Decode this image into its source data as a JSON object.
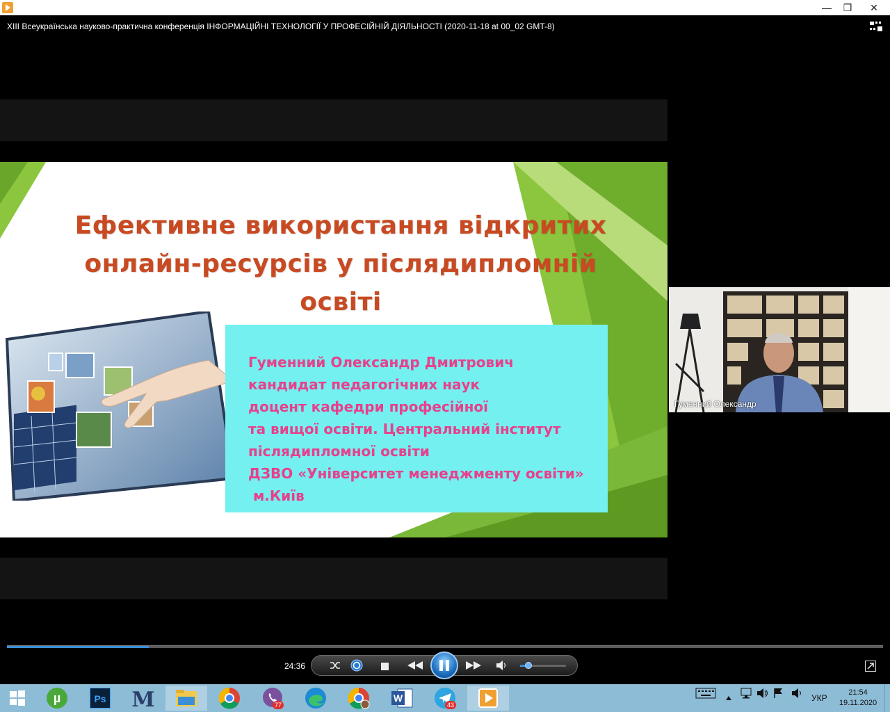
{
  "window": {
    "minimize_glyph": "—",
    "restore_glyph": "❐",
    "close_glyph": "✕"
  },
  "video": {
    "title": "XIII Всеукраїнська науково-практична конференція  ІНФОРМАЦІЙНІ ТЕХНОЛОГІЇ У ПРОФЕСІЙНІЙ ДІЯЛЬНОСТІ (2020-11-18 at 00_02 GMT-8)"
  },
  "slide": {
    "title_lines": [
      "Ефективне використання відкритих",
      "онлайн-ресурсів у післядипломній",
      "освіті"
    ],
    "author_lines": [
      "Гуменний Олександр Дмитрович",
      "кандидат педагогічних наук",
      "доцент кафедри професійної",
      "та вищої освіти. Центральний інститут",
      "післядипломної освіти",
      "ДЗВО «Університет менеджменту освіти»",
      " м.Київ"
    ],
    "colors": {
      "title": "#c84a22",
      "author": "#e8408c",
      "box": "#74f0f0",
      "accent_green": "#8cc63f"
    }
  },
  "participant": {
    "name": "Гуменний Олександр"
  },
  "player": {
    "elapsed": "24:36",
    "progress_fraction": 0.162,
    "volume_fraction": 0.18,
    "icons": {
      "shuffle": "shuffle-icon",
      "repeat": "repeat-icon",
      "stop": "stop-icon",
      "rewind": "rewind-icon",
      "pause": "pause-icon",
      "forward": "fast-forward-icon",
      "mute": "speaker-icon",
      "fullscreen": "switch-to-now-playing-icon"
    }
  },
  "taskbar": {
    "apps": [
      {
        "name": "start",
        "label": ""
      },
      {
        "name": "utorrent",
        "label": "µ"
      },
      {
        "name": "photoshop",
        "label": "Ps"
      },
      {
        "name": "mendeley",
        "label": "M"
      },
      {
        "name": "file-explorer",
        "label": ""
      },
      {
        "name": "chrome",
        "label": ""
      },
      {
        "name": "viber",
        "label": "",
        "badge": "77"
      },
      {
        "name": "edge",
        "label": ""
      },
      {
        "name": "chrome-profile",
        "label": ""
      },
      {
        "name": "word",
        "label": "W"
      },
      {
        "name": "telegram",
        "label": "",
        "badge": "43"
      },
      {
        "name": "media-player",
        "label": ""
      }
    ],
    "language": "УКР",
    "time": "21:54",
    "date": "19.11.2020"
  }
}
